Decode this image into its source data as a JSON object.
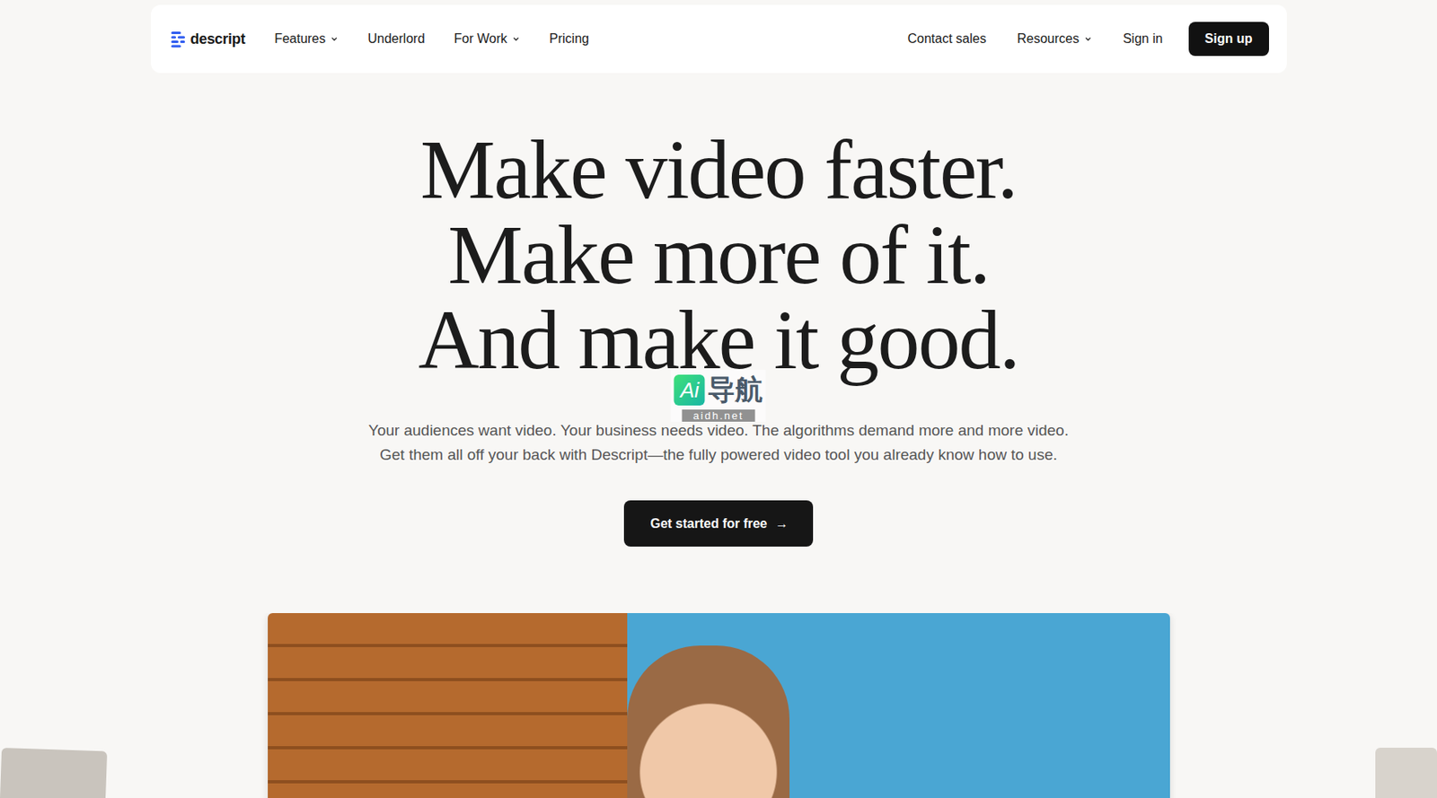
{
  "nav": {
    "logo": "descript",
    "items": [
      {
        "label": "Features",
        "has_menu": true
      },
      {
        "label": "Underlord",
        "has_menu": false
      },
      {
        "label": "For Work",
        "has_menu": true
      },
      {
        "label": "Pricing",
        "has_menu": false
      }
    ],
    "right_items": [
      {
        "label": "Contact sales",
        "has_menu": false
      },
      {
        "label": "Resources",
        "has_menu": true
      },
      {
        "label": "Sign in",
        "has_menu": false
      }
    ],
    "signup": "Sign up"
  },
  "hero": {
    "headline": [
      "Make video faster.",
      "Make more of it.",
      "And make it good."
    ],
    "subtext": [
      "Your audiences want video. Your business needs video. The algorithms demand more and more video.",
      "Get them all off your back with Descript—the fully powered video tool you already know how to use."
    ],
    "cta": {
      "label": "Get started for free",
      "arrow": "→"
    }
  },
  "watermark": {
    "logo": "Ai",
    "text": "导航",
    "url": "aidh.net"
  }
}
